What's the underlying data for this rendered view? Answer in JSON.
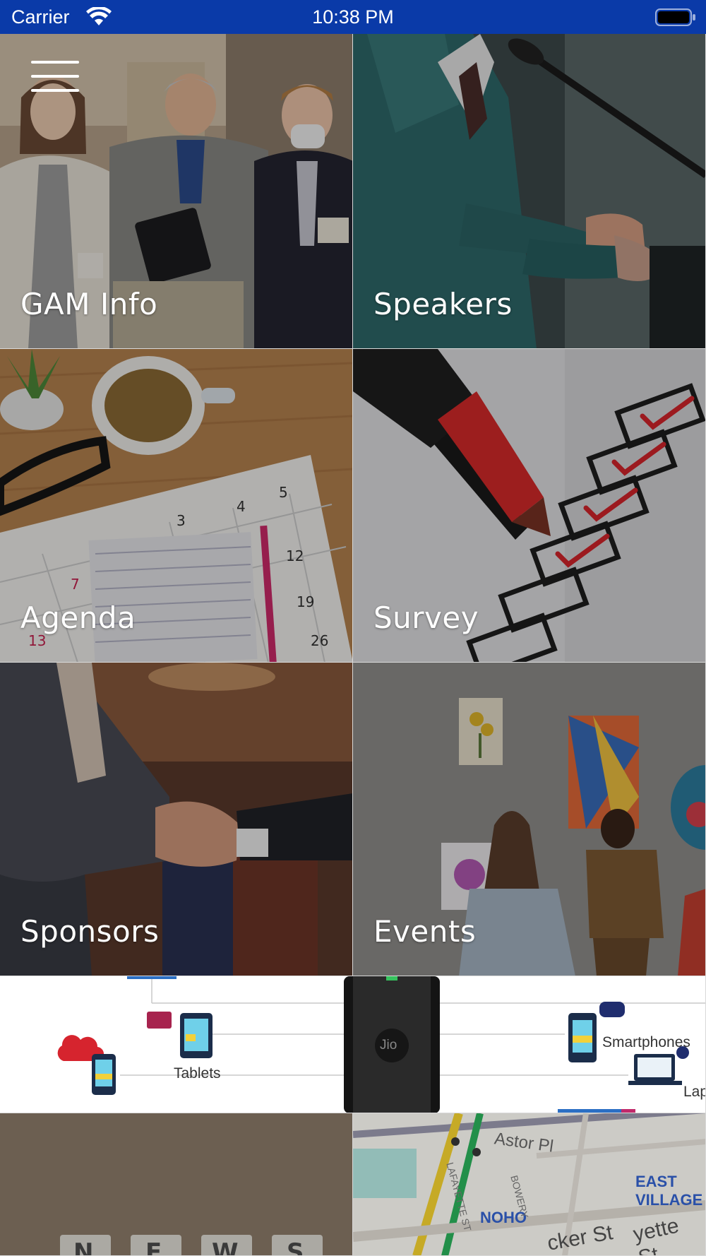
{
  "status_bar": {
    "carrier": "Carrier",
    "time": "10:38 PM",
    "wifi_icon": "wifi-icon",
    "battery_icon": "battery-full-icon",
    "background_color": "#0a3aa8"
  },
  "menu": {
    "icon": "hamburger-menu-icon"
  },
  "tiles": [
    {
      "label": "GAM Info",
      "photo": "attendees-group-photo"
    },
    {
      "label": "Speakers",
      "photo": "speaker-at-podium-photo"
    },
    {
      "label": "Agenda",
      "photo": "desk-calendar-photo"
    },
    {
      "label": "Survey",
      "photo": "checklist-marker-photo"
    },
    {
      "label": "Sponsors",
      "photo": "handshake-photo"
    },
    {
      "label": "Events",
      "photo": "art-gallery-photo"
    }
  ],
  "devices_banner": {
    "labels": [
      "Tablets",
      "Smartphones",
      "Lap"
    ],
    "phone_brand": "Jio"
  },
  "partial_tiles": [
    {
      "photo": "news-letter-tiles-photo",
      "letters": [
        "N",
        "E",
        "W",
        "S"
      ]
    },
    {
      "photo": "street-map-photo",
      "streets": [
        "Astor Pl",
        "EAST VILLAGE",
        "NOHO",
        "cker St",
        "yette St",
        "BOWERY",
        "LAFAYETTE ST"
      ]
    }
  ]
}
